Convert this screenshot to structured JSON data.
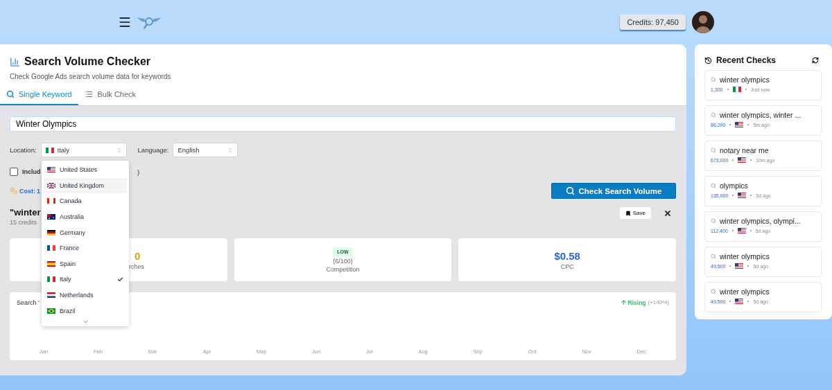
{
  "header": {
    "credits": "Credits: 97,450"
  },
  "page": {
    "title": "Search Volume Checker",
    "subtitle": "Check Google Ads search volume data for keywords"
  },
  "tabs": [
    {
      "label": "Single Keyword",
      "kind": "search",
      "selected": true
    },
    {
      "label": "Bulk Check",
      "kind": "list",
      "selected": false
    }
  ],
  "keyword_input": {
    "value": "Winter Olympics"
  },
  "location": {
    "label": "Location:",
    "value": "Italy",
    "kind": "it"
  },
  "language": {
    "label": "Language:",
    "value": "English"
  },
  "include_option": {
    "label": "Includ",
    "label_end": ")",
    "checked": false
  },
  "cost": {
    "label": "Cost:",
    "value": "1"
  },
  "check_button": "Check Search Volume",
  "result": {
    "heading": "\"winter",
    "note": "15 credits",
    "save": "Save"
  },
  "metrics": {
    "volume": {
      "value": "0",
      "label": "rches"
    },
    "competition": {
      "badge": "LOW",
      "score": "(6/100)",
      "label": "Competition"
    },
    "cpc": {
      "value": "$0.58",
      "label": "CPC"
    }
  },
  "trend": {
    "title": "Search '",
    "status": "Rising",
    "change": "(+140%)",
    "months": [
      "Jan",
      "Feb",
      "Mar",
      "Apr",
      "May",
      "Jun",
      "Jul",
      "Aug",
      "Sep",
      "Oct",
      "Nov",
      "Dec"
    ]
  },
  "location_menu": [
    {
      "name": "United States",
      "kind": "us",
      "selected": false,
      "highlighted": false
    },
    {
      "name": "United Kingdom",
      "kind": "gb",
      "selected": false,
      "highlighted": true
    },
    {
      "name": "Canada",
      "kind": "ca",
      "selected": false,
      "highlighted": false
    },
    {
      "name": "Australia",
      "kind": "au",
      "selected": false,
      "highlighted": false
    },
    {
      "name": "Germany",
      "kind": "de",
      "selected": false,
      "highlighted": false
    },
    {
      "name": "France",
      "kind": "fr",
      "selected": false,
      "highlighted": false
    },
    {
      "name": "Spain",
      "kind": "es",
      "selected": false,
      "highlighted": false
    },
    {
      "name": "Italy",
      "kind": "it",
      "selected": true,
      "highlighted": false
    },
    {
      "name": "Netherlands",
      "kind": "nl",
      "selected": false,
      "highlighted": false
    },
    {
      "name": "Brazil",
      "kind": "br",
      "selected": false,
      "highlighted": false
    }
  ],
  "recent": {
    "title": "Recent Checks",
    "items": [
      {
        "query": "winter olympics",
        "volume": "1,300",
        "kind": "it",
        "time": "Just now"
      },
      {
        "query": "winter olympics, winter ...",
        "volume": "86,290",
        "kind": "us",
        "time": "5m ago"
      },
      {
        "query": "notary near me",
        "volume": "673,000",
        "kind": "us",
        "time": "10m ago"
      },
      {
        "query": "olympics",
        "volume": "135,000",
        "kind": "us",
        "time": "5d ago"
      },
      {
        "query": "winter olympics, olympi...",
        "volume": "112,400",
        "kind": "us",
        "time": "5d ago"
      },
      {
        "query": "winter olympics",
        "volume": "49,500",
        "kind": "us",
        "time": "5d ago"
      },
      {
        "query": "winter olympics",
        "volume": "49,500",
        "kind": "us",
        "time": "5d ago"
      }
    ]
  }
}
